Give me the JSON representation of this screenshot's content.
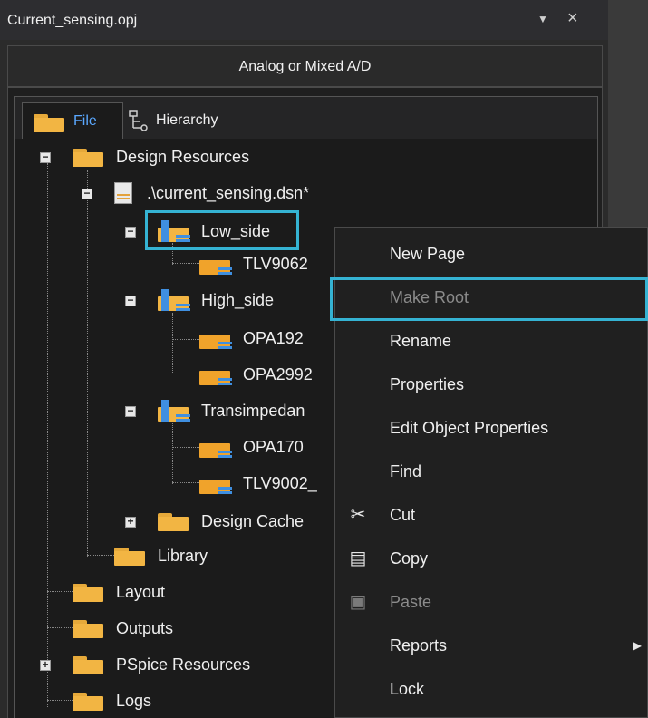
{
  "window": {
    "title": "Current_sensing.opj",
    "pin_icon": "dropdown-arrow-icon",
    "close_label": "×"
  },
  "mode": "Analog or Mixed A/D",
  "tabs": [
    {
      "label": "File",
      "active": true
    },
    {
      "label": "Hierarchy",
      "active": false
    }
  ],
  "tree": {
    "design_resources": "Design Resources",
    "dsn_file": ".\\current_sensing.dsn*",
    "low_side": "Low_side",
    "tlv9062": "TLV9062",
    "high_side": "High_side",
    "opa192": "OPA192",
    "opa2992": "OPA2992",
    "transimpedance": "Transimpedan",
    "opa170": "OPA170",
    "tlv9002": "TLV9002_",
    "design_cache": "Design Cache",
    "library": "Library",
    "layout": "Layout",
    "outputs": "Outputs",
    "pspice_resources": "PSpice Resources",
    "logs": "Logs"
  },
  "context_menu": {
    "items": [
      {
        "label": "New Page",
        "enabled": true
      },
      {
        "label": "Make Root",
        "enabled": false
      },
      {
        "label": "Rename",
        "enabled": true
      },
      {
        "label": "Properties",
        "enabled": true
      },
      {
        "label": "Edit Object Properties",
        "enabled": true
      },
      {
        "label": "Find",
        "enabled": true
      },
      {
        "label": "Cut",
        "enabled": true,
        "icon": "scissors-icon"
      },
      {
        "label": "Copy",
        "enabled": true,
        "icon": "copy-icon"
      },
      {
        "label": "Paste",
        "enabled": false,
        "icon": "paste-icon"
      },
      {
        "label": "Reports",
        "enabled": true,
        "submenu": true
      },
      {
        "label": "Lock",
        "enabled": true
      }
    ]
  },
  "colors": {
    "highlight": "#35b3d3",
    "folder": "#f2b543",
    "active_tab_text": "#5aa8ff"
  }
}
